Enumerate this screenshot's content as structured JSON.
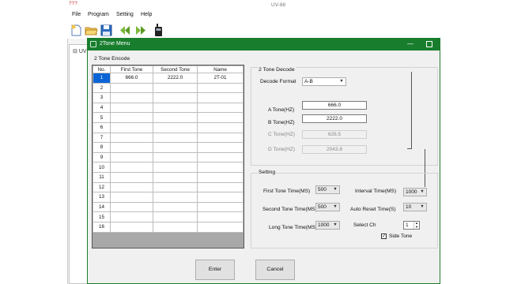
{
  "app": {
    "logo": "???",
    "title": "UV-88",
    "menu": [
      "File",
      "Program",
      "Setting",
      "Help"
    ],
    "toolbar_icons": [
      "new-file-icon",
      "open-folder-icon",
      "save-icon",
      "read-radio-icon",
      "write-radio-icon",
      "radio-device-icon"
    ],
    "tree_root": "UV"
  },
  "dialog": {
    "title": "2Tone Menu",
    "encode": {
      "group_label": "2 Tone Encode",
      "columns": [
        "No.",
        "First Tone",
        "Second Tone",
        "Name"
      ],
      "rows": [
        {
          "no": "1",
          "first": "666.0",
          "second": "2222.0",
          "name": "2T-01"
        },
        {
          "no": "2",
          "first": "",
          "second": "",
          "name": ""
        },
        {
          "no": "3",
          "first": "",
          "second": "",
          "name": ""
        },
        {
          "no": "4",
          "first": "",
          "second": "",
          "name": ""
        },
        {
          "no": "5",
          "first": "",
          "second": "",
          "name": ""
        },
        {
          "no": "6",
          "first": "",
          "second": "",
          "name": ""
        },
        {
          "no": "7",
          "first": "",
          "second": "",
          "name": ""
        },
        {
          "no": "8",
          "first": "",
          "second": "",
          "name": ""
        },
        {
          "no": "9",
          "first": "",
          "second": "",
          "name": ""
        },
        {
          "no": "10",
          "first": "",
          "second": "",
          "name": ""
        },
        {
          "no": "11",
          "first": "",
          "second": "",
          "name": ""
        },
        {
          "no": "12",
          "first": "",
          "second": "",
          "name": ""
        },
        {
          "no": "13",
          "first": "",
          "second": "",
          "name": ""
        },
        {
          "no": "14",
          "first": "",
          "second": "",
          "name": ""
        },
        {
          "no": "15",
          "first": "",
          "second": "",
          "name": ""
        },
        {
          "no": "16",
          "first": "",
          "second": "",
          "name": ""
        }
      ]
    },
    "decode": {
      "group_label": "2 Tone Decode",
      "format_label": "Decode Format",
      "format_value": "A-B",
      "a_label": "A Tone(HZ)",
      "a_value": "666.0",
      "b_label": "B Tone(HZ)",
      "b_value": "2222.0",
      "c_label": "C Tone(HZ)",
      "c_value": "626.5",
      "d_label": "D Tone(HZ)",
      "d_value": "2043.8"
    },
    "setting": {
      "group_label": "Setting",
      "first_label": "First Tone Time(MS)",
      "first_value": "500",
      "second_label": "Second Tone Time(MS)",
      "second_value": "500",
      "long_label": "Long Tone Time(MS)",
      "long_value": "1000",
      "interval_label": "Interval Time(MS)",
      "interval_value": "1000",
      "reset_label": "Auto Reset Time(S)",
      "reset_value": "10",
      "select_label": "Select Ch",
      "select_value": "1",
      "side_label": "Side Tone",
      "side_checked": true
    },
    "enter_label": "Enter",
    "cancel_label": "Cancel"
  }
}
